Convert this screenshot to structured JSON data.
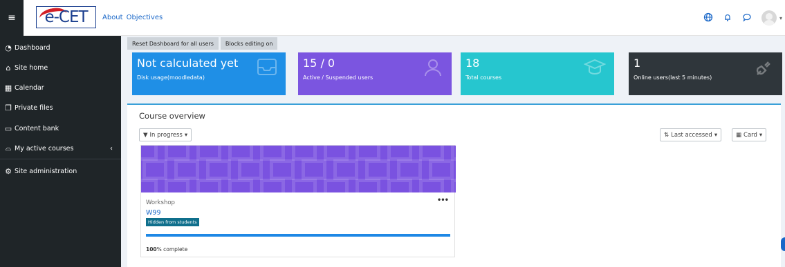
{
  "navbar": {
    "menu_icon": "hamburger-icon",
    "logo_text": "e-CET",
    "links": [
      "About",
      "Objectives"
    ],
    "icons": [
      "globe-icon",
      "bell-icon",
      "chat-icon",
      "user-avatar-icon"
    ]
  },
  "sidebar": {
    "items": [
      {
        "label": "Dashboard",
        "icon": "dashboard-icon"
      },
      {
        "label": "Site home",
        "icon": "home-icon"
      },
      {
        "label": "Calendar",
        "icon": "calendar-icon"
      },
      {
        "label": "Private files",
        "icon": "file-icon"
      },
      {
        "label": "Content bank",
        "icon": "bank-icon"
      },
      {
        "label": "My active courses",
        "icon": "graduation-cap-icon"
      },
      {
        "label": "Site administration",
        "icon": "gear-icon"
      }
    ]
  },
  "toolbar": {
    "reset_label": "Reset Dashboard for all users",
    "editing_label": "Blocks editing on"
  },
  "stats": [
    {
      "value": "Not calculated yet",
      "label": "Disk usage(moodledata)",
      "icon": "inbox-icon",
      "color": "#1f8fe6"
    },
    {
      "value": "15 / 0",
      "label": "Active / Suspended users",
      "icon": "users-icon",
      "color": "#7b55e0"
    },
    {
      "value": "18",
      "label": "Total courses",
      "icon": "graduation-cap-icon",
      "color": "#26c6cf"
    },
    {
      "value": "1",
      "label": "Online users(last 5 minutes)",
      "icon": "plug-icon",
      "color": "#2f363b"
    }
  ],
  "course_overview": {
    "title": "Course overview",
    "filter_label": "In progress",
    "sort_label": "Last accessed",
    "view_label": "Card",
    "course": {
      "category": "Workshop",
      "name": "W99",
      "badge": "Hidden from students",
      "progress_fraction": 1.0,
      "percent_text": "100",
      "percent_suffix": "% complete",
      "banner_color": "#7a52e0"
    }
  }
}
